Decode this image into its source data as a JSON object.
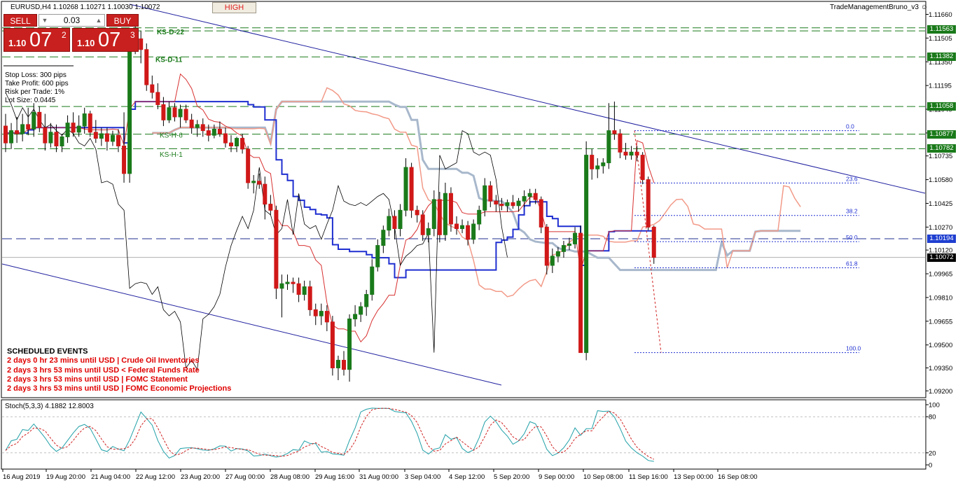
{
  "chart": {
    "symbol_title": "EURUSD,H4  1.10268 1.10271 1.10030 1.10072",
    "ea_name": "TradeManagementBruno_v3",
    "high_button": "HIGH"
  },
  "trade_panel": {
    "sell_label": "SELL",
    "buy_label": "BUY",
    "lot_size": "0.03",
    "sell_price": {
      "prefix": "1.10",
      "big": "07",
      "sup": "2"
    },
    "buy_price": {
      "prefix": "1.10",
      "big": "07",
      "sup": "3"
    }
  },
  "risk_info": [
    "Stop Loss: 300 pips",
    "Take Profit: 600 pips",
    "Risk per Trade: 1%",
    "Lot Size: 0.0445"
  ],
  "scheduled_events": {
    "title": "SCHEDULED EVENTS",
    "items": [
      "2 days 0 hr 23 mins until USD  |  Crude Oil Inventories",
      "2 days 3 hrs 53 mins until USD  <  Federal Funds Rate",
      "2 days 3 hrs 53 mins until USD  |  FOMC Statement",
      "2 days 3 hrs 53 mins until USD  |  FOMC Economic Projections"
    ]
  },
  "line_labels": {
    "ks_d_22": "KS-D-22",
    "ks_d_11": "KS-D-11",
    "ks_h_6": "KS-H-6",
    "ks_h_1": "KS-H-1"
  },
  "price_axis_ticks": [
    "1.11660",
    "1.11505",
    "1.11350",
    "1.11195",
    "1.11040",
    "1.10885",
    "1.10735",
    "1.10580",
    "1.10425",
    "1.10270",
    "1.10120",
    "1.09965",
    "1.09810",
    "1.09655",
    "1.09500",
    "1.09350",
    "1.09200"
  ],
  "price_tags": [
    {
      "label": "1.11563",
      "color": "#1a7a1a"
    },
    {
      "label": "1.11382",
      "color": "#1a7a1a"
    },
    {
      "label": "1.11058",
      "color": "#1a7a1a"
    },
    {
      "label": "1.10877",
      "color": "#1a7a1a"
    },
    {
      "label": "1.10782",
      "color": "#1a7a1a"
    },
    {
      "label": "1.10194",
      "color": "#1f3fd0"
    },
    {
      "label": "1.10072",
      "color": "#000000"
    }
  ],
  "fib_levels": [
    "0.0",
    "23.6",
    "38.2",
    "50.0",
    "61.8",
    "100.0"
  ],
  "stoch": {
    "label": "Stoch(5,3,3) 4.1882 12.8003",
    "ticks": [
      "100",
      "80",
      "20",
      "0"
    ]
  },
  "time_axis": [
    "16 Aug 2019",
    "19 Aug 20:00",
    "21 Aug 04:00",
    "22 Aug 12:00",
    "23 Aug 20:00",
    "27 Aug 00:00",
    "28 Aug 08:00",
    "29 Aug 16:00",
    "31 Aug 00:00",
    "3 Sep 04:00",
    "4 Sep 12:00",
    "5 Sep 20:00",
    "9 Sep 00:00",
    "10 Sep 08:00",
    "11 Sep 16:00",
    "13 Sep 00:00",
    "16 Sep 08:00"
  ],
  "colors": {
    "bull": "#1a7a1a",
    "bear": "#d01818",
    "kijun": "#1f2fd0",
    "cloud": "#a8b8cc",
    "senkou": "#f29a88",
    "green_level": "#1a7a1a",
    "fib": "#2030d0"
  },
  "candles": [
    {
      "o": 1.1093,
      "h": 1.1101,
      "l": 1.1076,
      "c": 1.1082
    },
    {
      "o": 1.1082,
      "h": 1.1095,
      "l": 1.1078,
      "c": 1.109
    },
    {
      "o": 1.109,
      "h": 1.1099,
      "l": 1.1082,
      "c": 1.1088
    },
    {
      "o": 1.1088,
      "h": 1.1101,
      "l": 1.1083,
      "c": 1.1094
    },
    {
      "o": 1.1094,
      "h": 1.1105,
      "l": 1.1087,
      "c": 1.1091
    },
    {
      "o": 1.1091,
      "h": 1.1108,
      "l": 1.1086,
      "c": 1.1102
    },
    {
      "o": 1.1102,
      "h": 1.1106,
      "l": 1.1089,
      "c": 1.1092
    },
    {
      "o": 1.1092,
      "h": 1.1101,
      "l": 1.1077,
      "c": 1.1082
    },
    {
      "o": 1.1082,
      "h": 1.1095,
      "l": 1.1079,
      "c": 1.1089
    },
    {
      "o": 1.1089,
      "h": 1.1094,
      "l": 1.1076,
      "c": 1.108
    },
    {
      "o": 1.108,
      "h": 1.1088,
      "l": 1.1076,
      "c": 1.1086
    },
    {
      "o": 1.1086,
      "h": 1.11,
      "l": 1.1082,
      "c": 1.1095
    },
    {
      "o": 1.1095,
      "h": 1.1102,
      "l": 1.1086,
      "c": 1.1089
    },
    {
      "o": 1.1089,
      "h": 1.11,
      "l": 1.1086,
      "c": 1.1093
    },
    {
      "o": 1.1093,
      "h": 1.1105,
      "l": 1.1088,
      "c": 1.1101
    },
    {
      "o": 1.1101,
      "h": 1.1103,
      "l": 1.1086,
      "c": 1.1089
    },
    {
      "o": 1.1089,
      "h": 1.1097,
      "l": 1.1082,
      "c": 1.1085
    },
    {
      "o": 1.1085,
      "h": 1.1092,
      "l": 1.108,
      "c": 1.1088
    },
    {
      "o": 1.1088,
      "h": 1.1092,
      "l": 1.1077,
      "c": 1.1083
    },
    {
      "o": 1.1083,
      "h": 1.109,
      "l": 1.108,
      "c": 1.1087
    },
    {
      "o": 1.1087,
      "h": 1.1091,
      "l": 1.1076,
      "c": 1.108
    },
    {
      "o": 1.108,
      "h": 1.1102,
      "l": 1.1056,
      "c": 1.1062
    },
    {
      "o": 1.1062,
      "h": 1.1152,
      "l": 1.1056,
      "c": 1.1145
    },
    {
      "o": 1.1145,
      "h": 1.1162,
      "l": 1.114,
      "c": 1.115
    },
    {
      "o": 1.115,
      "h": 1.1155,
      "l": 1.1134,
      "c": 1.1143
    },
    {
      "o": 1.1143,
      "h": 1.1147,
      "l": 1.1116,
      "c": 1.112
    },
    {
      "o": 1.112,
      "h": 1.1126,
      "l": 1.1111,
      "c": 1.1115
    },
    {
      "o": 1.1115,
      "h": 1.1121,
      "l": 1.1104,
      "c": 1.1107
    },
    {
      "o": 1.1107,
      "h": 1.1112,
      "l": 1.1093,
      "c": 1.1097
    },
    {
      "o": 1.1097,
      "h": 1.1109,
      "l": 1.1095,
      "c": 1.1105
    },
    {
      "o": 1.1105,
      "h": 1.1108,
      "l": 1.1096,
      "c": 1.1099
    },
    {
      "o": 1.1099,
      "h": 1.1107,
      "l": 1.1092,
      "c": 1.1104
    },
    {
      "o": 1.1104,
      "h": 1.1107,
      "l": 1.1095,
      "c": 1.1097
    },
    {
      "o": 1.1097,
      "h": 1.1101,
      "l": 1.1088,
      "c": 1.1092
    },
    {
      "o": 1.1092,
      "h": 1.1097,
      "l": 1.1086,
      "c": 1.1094
    },
    {
      "o": 1.1094,
      "h": 1.1098,
      "l": 1.1086,
      "c": 1.109
    },
    {
      "o": 1.109,
      "h": 1.1094,
      "l": 1.1083,
      "c": 1.1087
    },
    {
      "o": 1.1087,
      "h": 1.1094,
      "l": 1.1085,
      "c": 1.1091
    },
    {
      "o": 1.1091,
      "h": 1.1096,
      "l": 1.1086,
      "c": 1.1088
    },
    {
      "o": 1.1088,
      "h": 1.1092,
      "l": 1.1079,
      "c": 1.1082
    },
    {
      "o": 1.1082,
      "h": 1.1087,
      "l": 1.1076,
      "c": 1.108
    },
    {
      "o": 1.108,
      "h": 1.1086,
      "l": 1.1076,
      "c": 1.1085
    },
    {
      "o": 1.1085,
      "h": 1.1088,
      "l": 1.1075,
      "c": 1.1078
    },
    {
      "o": 1.1078,
      "h": 1.108,
      "l": 1.1052,
      "c": 1.1056
    },
    {
      "o": 1.1056,
      "h": 1.1061,
      "l": 1.1049,
      "c": 1.1057
    },
    {
      "o": 1.1057,
      "h": 1.1062,
      "l": 1.1052,
      "c": 1.1055
    },
    {
      "o": 1.1055,
      "h": 1.106,
      "l": 1.1032,
      "c": 1.1042
    },
    {
      "o": 1.1042,
      "h": 1.1048,
      "l": 1.1035,
      "c": 1.1038
    },
    {
      "o": 1.1038,
      "h": 1.1041,
      "l": 1.098,
      "c": 1.0987
    },
    {
      "o": 1.0987,
      "h": 1.0996,
      "l": 1.0968,
      "c": 1.099
    },
    {
      "o": 1.099,
      "h": 1.0996,
      "l": 1.0986,
      "c": 1.0991
    },
    {
      "o": 1.0991,
      "h": 1.0994,
      "l": 1.0984,
      "c": 1.099
    },
    {
      "o": 1.099,
      "h": 1.0994,
      "l": 1.0978,
      "c": 1.0983
    },
    {
      "o": 1.0983,
      "h": 1.0992,
      "l": 1.0979,
      "c": 1.0988
    },
    {
      "o": 1.0988,
      "h": 1.0992,
      "l": 1.0969,
      "c": 1.0973
    },
    {
      "o": 1.0973,
      "h": 1.0977,
      "l": 1.0963,
      "c": 1.0969
    },
    {
      "o": 1.0969,
      "h": 1.0977,
      "l": 1.0963,
      "c": 1.0972
    },
    {
      "o": 1.0972,
      "h": 1.0976,
      "l": 1.0959,
      "c": 1.0965
    },
    {
      "o": 1.0965,
      "h": 1.0969,
      "l": 1.093,
      "c": 1.0935
    },
    {
      "o": 1.0935,
      "h": 1.0943,
      "l": 1.0927,
      "c": 1.094
    },
    {
      "o": 1.094,
      "h": 1.0946,
      "l": 1.093,
      "c": 1.0934
    },
    {
      "o": 1.0934,
      "h": 1.097,
      "l": 1.0926,
      "c": 1.0967
    },
    {
      "o": 1.0967,
      "h": 1.0976,
      "l": 1.0962,
      "c": 1.097
    },
    {
      "o": 1.097,
      "h": 1.0978,
      "l": 1.0965,
      "c": 1.0975
    },
    {
      "o": 1.0975,
      "h": 1.0986,
      "l": 1.0969,
      "c": 1.0983
    },
    {
      "o": 1.0983,
      "h": 1.1006,
      "l": 1.0979,
      "c": 1.1001
    },
    {
      "o": 1.1001,
      "h": 1.1019,
      "l": 1.0998,
      "c": 1.1015
    },
    {
      "o": 1.1015,
      "h": 1.1028,
      "l": 1.101,
      "c": 1.1025
    },
    {
      "o": 1.1025,
      "h": 1.1039,
      "l": 1.1021,
      "c": 1.1034
    },
    {
      "o": 1.1034,
      "h": 1.1038,
      "l": 1.1019,
      "c": 1.1026
    },
    {
      "o": 1.1026,
      "h": 1.1042,
      "l": 1.1021,
      "c": 1.1038
    },
    {
      "o": 1.1038,
      "h": 1.1072,
      "l": 1.1034,
      "c": 1.1066
    },
    {
      "o": 1.1066,
      "h": 1.1069,
      "l": 1.1033,
      "c": 1.1038
    },
    {
      "o": 1.1038,
      "h": 1.1041,
      "l": 1.103,
      "c": 1.1035
    },
    {
      "o": 1.1035,
      "h": 1.1038,
      "l": 1.1018,
      "c": 1.1022
    },
    {
      "o": 1.1022,
      "h": 1.103,
      "l": 1.1017,
      "c": 1.1026
    },
    {
      "o": 1.1026,
      "h": 1.1051,
      "l": 1.1021,
      "c": 1.1045
    },
    {
      "o": 1.1045,
      "h": 1.105,
      "l": 1.1017,
      "c": 1.1022
    },
    {
      "o": 1.1022,
      "h": 1.1056,
      "l": 1.1018,
      "c": 1.1049
    },
    {
      "o": 1.1049,
      "h": 1.1053,
      "l": 1.1024,
      "c": 1.1029
    },
    {
      "o": 1.1029,
      "h": 1.1034,
      "l": 1.1022,
      "c": 1.1026
    },
    {
      "o": 1.1026,
      "h": 1.1032,
      "l": 1.1023,
      "c": 1.1028
    },
    {
      "o": 1.1028,
      "h": 1.1031,
      "l": 1.1015,
      "c": 1.1019
    },
    {
      "o": 1.1019,
      "h": 1.1032,
      "l": 1.1016,
      "c": 1.1029
    },
    {
      "o": 1.1029,
      "h": 1.1041,
      "l": 1.1025,
      "c": 1.1038
    },
    {
      "o": 1.1038,
      "h": 1.1059,
      "l": 1.1034,
      "c": 1.1054
    },
    {
      "o": 1.1054,
      "h": 1.1057,
      "l": 1.104,
      "c": 1.1044
    },
    {
      "o": 1.1044,
      "h": 1.1048,
      "l": 1.1037,
      "c": 1.1042
    },
    {
      "o": 1.1042,
      "h": 1.1046,
      "l": 1.1038,
      "c": 1.1041
    },
    {
      "o": 1.1041,
      "h": 1.1045,
      "l": 1.1037,
      "c": 1.1043
    },
    {
      "o": 1.1043,
      "h": 1.1048,
      "l": 1.1039,
      "c": 1.1041
    },
    {
      "o": 1.1041,
      "h": 1.1046,
      "l": 1.1037,
      "c": 1.1044
    },
    {
      "o": 1.1044,
      "h": 1.1051,
      "l": 1.104,
      "c": 1.1047
    },
    {
      "o": 1.1047,
      "h": 1.1052,
      "l": 1.1042,
      "c": 1.1049
    },
    {
      "o": 1.1049,
      "h": 1.1052,
      "l": 1.1042,
      "c": 1.1045
    },
    {
      "o": 1.1045,
      "h": 1.1047,
      "l": 1.1023,
      "c": 1.1027
    },
    {
      "o": 1.1027,
      "h": 1.1029,
      "l": 1.0996,
      "c": 1.1002
    },
    {
      "o": 1.1002,
      "h": 1.1013,
      "l": 1.0997,
      "c": 1.1008
    },
    {
      "o": 1.1008,
      "h": 1.1014,
      "l": 1.1004,
      "c": 1.1011
    },
    {
      "o": 1.1011,
      "h": 1.1018,
      "l": 1.1007,
      "c": 1.1015
    },
    {
      "o": 1.1015,
      "h": 1.102,
      "l": 1.1012,
      "c": 1.1016
    },
    {
      "o": 1.1016,
      "h": 1.1027,
      "l": 1.1013,
      "c": 1.1023
    },
    {
      "o": 1.1023,
      "h": 1.1028,
      "l": 1.0945,
      "c": 1.0945
    },
    {
      "o": 1.0945,
      "h": 1.1083,
      "l": 1.094,
      "c": 1.1074
    },
    {
      "o": 1.1074,
      "h": 1.1078,
      "l": 1.1058,
      "c": 1.1065
    },
    {
      "o": 1.1065,
      "h": 1.1072,
      "l": 1.1059,
      "c": 1.1067
    },
    {
      "o": 1.1067,
      "h": 1.1072,
      "l": 1.1062,
      "c": 1.1069
    },
    {
      "o": 1.1069,
      "h": 1.1108,
      "l": 1.1065,
      "c": 1.109
    },
    {
      "o": 1.109,
      "h": 1.1109,
      "l": 1.1084,
      "c": 1.1088
    },
    {
      "o": 1.1088,
      "h": 1.1091,
      "l": 1.1072,
      "c": 1.1076
    },
    {
      "o": 1.1076,
      "h": 1.1082,
      "l": 1.1071,
      "c": 1.1074
    },
    {
      "o": 1.1074,
      "h": 1.108,
      "l": 1.1071,
      "c": 1.1076
    },
    {
      "o": 1.1076,
      "h": 1.108,
      "l": 1.107,
      "c": 1.1074
    },
    {
      "o": 1.1074,
      "h": 1.1076,
      "l": 1.1055,
      "c": 1.1058
    },
    {
      "o": 1.1058,
      "h": 1.106,
      "l": 1.1025,
      "c": 1.1027
    },
    {
      "o": 1.1027,
      "h": 1.1028,
      "l": 1.1003,
      "c": 1.10072
    }
  ]
}
